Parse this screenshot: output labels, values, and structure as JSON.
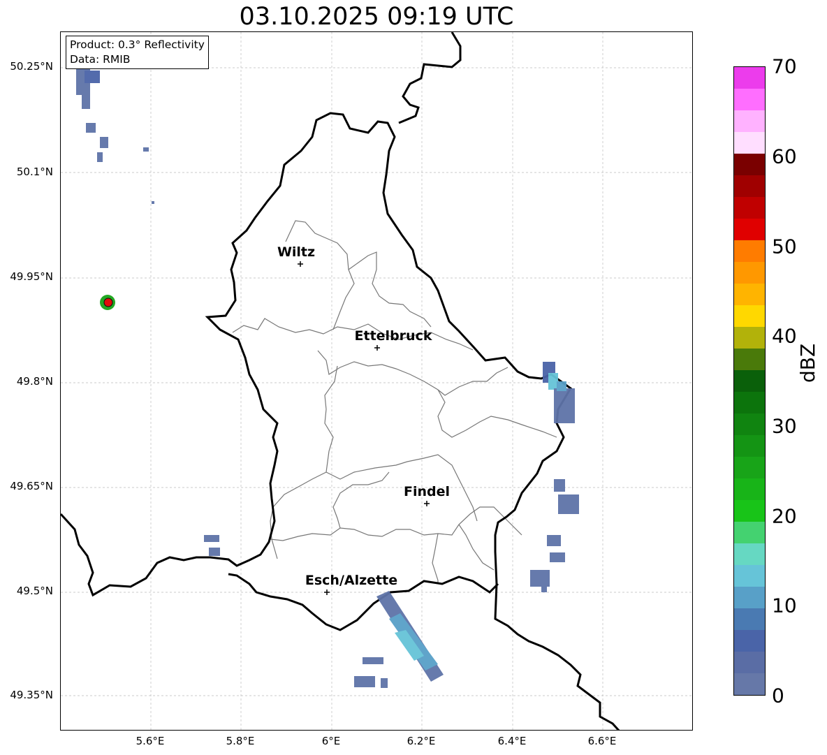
{
  "map": {
    "title": "03.10.2025 09:19 UTC",
    "info_product": "Product: 0.3° Reflectivity",
    "info_data": "Data: RMIB",
    "lat_labels": [
      "50.25°N",
      "50.1°N",
      "49.95°N",
      "49.8°N",
      "49.65°N",
      "49.5°N",
      "49.35°N"
    ],
    "lon_labels": [
      "5.6°E",
      "5.8°E",
      "6°E",
      "6.2°E",
      "6.4°E",
      "6.6°E"
    ],
    "cities": [
      "Wiltz",
      "Ettelbruck",
      "Findel",
      "Esch/Alzette"
    ]
  },
  "colorbar": {
    "label": "dBZ",
    "ticks": [
      "0",
      "10",
      "20",
      "30",
      "40",
      "50",
      "60",
      "70"
    ],
    "colors": [
      "#6678a8",
      "#5a6da5",
      "#4a64a8",
      "#4a7ab2",
      "#58a0c8",
      "#66c4d8",
      "#66d8c2",
      "#44d270",
      "#18c418",
      "#18b418",
      "#18a418",
      "#149414",
      "#108410",
      "#0c740c",
      "#0a600a",
      "#4a7a0a",
      "#b2b20a",
      "#ffd800",
      "#ffb400",
      "#ff9800",
      "#ff7c00",
      "#e00000",
      "#c00000",
      "#a00000",
      "#7a0000",
      "#ffdeff",
      "#ffb2ff",
      "#ff6eff",
      "#ec3cec"
    ]
  },
  "radar_colors": {
    "weak": "#5e73a8",
    "mid": "#4a64a8",
    "light": "#58a0c8",
    "cyan": "#66c4d8",
    "green": "#18a418",
    "site": "#e00000"
  }
}
